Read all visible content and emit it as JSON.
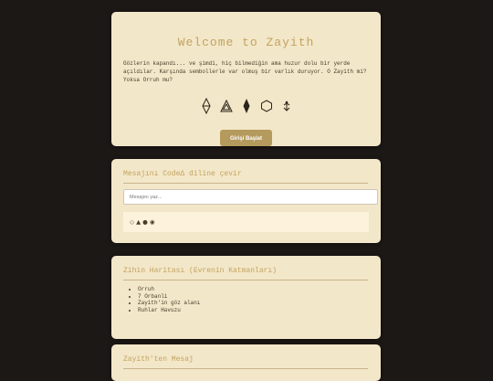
{
  "welcome": {
    "title": "Welcome to Zayith",
    "text": "Gözlerin kapandı... ve şimdi, hiç bilmediğin ama huzur dolu bir yerde açıldılar. Karşında sembollerle var olmuş bir varlık duruyor. O Zayith mi? Yoksa Orruh mu?",
    "symbols": [
      {
        "name": "diamond-outline-icon"
      },
      {
        "name": "nested-triangle-icon"
      },
      {
        "name": "filled-diamond-icon"
      },
      {
        "name": "hexagon-icon"
      },
      {
        "name": "sprout-icon"
      }
    ],
    "start_button": "Girişi Başlat"
  },
  "translate": {
    "title": "Mesajını CodeΔ diline çevir",
    "input_placeholder": "Mesajını yaz...",
    "output": "◇ ▲ ● ◉"
  },
  "map": {
    "title": "Zihin Haritası (Evrenin Katmanları)",
    "items": [
      "Orruh",
      "7 Orbanli",
      "Zayith'in göz alanı",
      "Ruhlar Havuzu"
    ]
  },
  "message": {
    "title": "Zayith'ten Mesaj"
  },
  "colors": {
    "background": "#1c1816",
    "card": "#f3e7c9",
    "accent": "#c2a35e",
    "button": "#b59a5d"
  }
}
